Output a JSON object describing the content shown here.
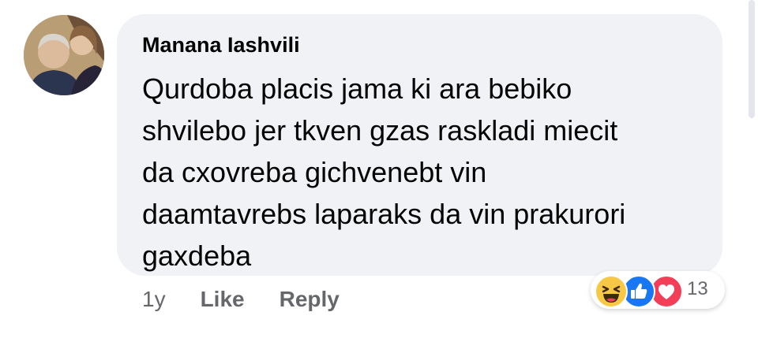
{
  "comment": {
    "author": "Manana Iashvili",
    "text_lines": [
      "Qurdoba placis jama ki ara bebiko",
      "shvilebo jer tkven gzas raskladi miecit",
      "da cxovreba gichvenebt vin",
      "daamtavrebs laparaks da vin prakurori",
      "gaxdeba"
    ]
  },
  "actions": {
    "time": "1y",
    "like_label": "Like",
    "reply_label": "Reply"
  },
  "reactions": {
    "icons": [
      "haha-icon",
      "like-icon",
      "love-icon"
    ],
    "count": "13"
  },
  "colors": {
    "bubble": "#f0f2f5",
    "text": "#050505",
    "muted": "#65676b",
    "like_blue": "#1877f2",
    "love_red": "#f33e58",
    "haha_yellow": "#f7c843"
  }
}
